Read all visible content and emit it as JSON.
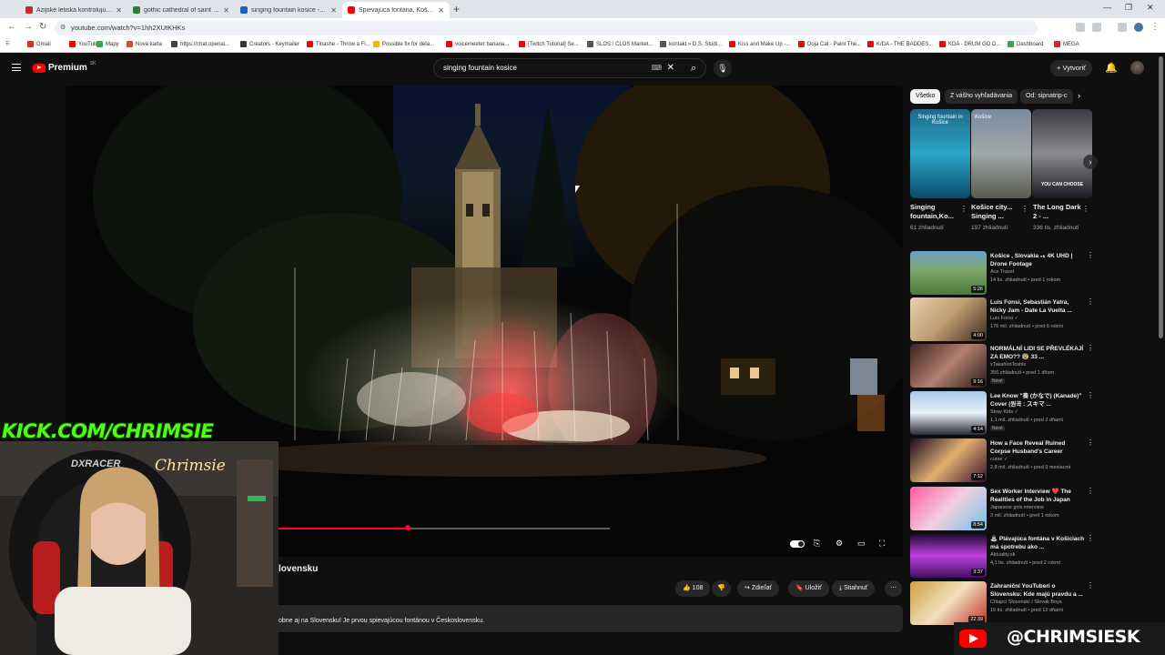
{
  "browser": {
    "tabs": [
      {
        "title": "Ázijské letiská kontrolujú cestu",
        "color": "#c62828"
      },
      {
        "title": "gothic cathedral of saint elizab",
        "color": "#2e7d32"
      },
      {
        "title": "singing fountain kosice - Hľadať",
        "color": "#1565c0"
      },
      {
        "title": "Spievajúca fontána, Košice - no",
        "color": "#ff0000"
      }
    ],
    "url": "youtube.com/watch?v=1hh2XUtKHKs",
    "bookmarks": [
      {
        "label": "Gmail",
        "color": "#d93025"
      },
      {
        "label": "YouTube",
        "color": "#ff0000"
      },
      {
        "label": "Mapy",
        "color": "#34a853"
      },
      {
        "label": "Nová karta",
        "color": "#ea4335"
      },
      {
        "label": "https://chat.openai...",
        "color": "#444"
      },
      {
        "label": "Creators - Keymailer",
        "color": "#333"
      },
      {
        "label": "Tinashe - Throw a Fi...",
        "color": "#ff0000"
      },
      {
        "label": "Possible fix for dela...",
        "color": "#f4b400"
      },
      {
        "label": "voicemeeter banana...",
        "color": "#ff0000"
      },
      {
        "label": "[Twitch Tutorial] Se...",
        "color": "#ff0000"
      },
      {
        "label": "SLOS / CLOS Market...",
        "color": "#555"
      },
      {
        "label": "kontakt » D.S. Studi...",
        "color": "#555"
      },
      {
        "label": "Kiss and Make Up -...",
        "color": "#ff0000"
      },
      {
        "label": "Doja Cat - Paint The...",
        "color": "#ff0000"
      },
      {
        "label": "K/DA - THE BADDES...",
        "color": "#ff0000"
      },
      {
        "label": "KDA - DRUM GO D...",
        "color": "#ff0000"
      },
      {
        "label": "Dashboard",
        "color": "#34a853"
      },
      {
        "label": "MEGA",
        "color": "#d9272e"
      }
    ]
  },
  "yt": {
    "logo_text": "Premium",
    "logo_region": "SK",
    "search_value": "singing fountain kosice",
    "create_label": "Vytvoriť",
    "create_plus": "+"
  },
  "video": {
    "title_visible": "lovensku",
    "progress": 0.39,
    "actions": {
      "like_count": "108",
      "share": "Zdieľať",
      "save": "Uložiť",
      "download": "Stiahnuť"
    },
    "description": "obne aj na Slovensku! Je prvou spievajúcou fontánou v Československu."
  },
  "sidebar": {
    "chips": [
      "Všetko",
      "Z vášho vyhľadávania",
      "Od: sipnatrip-c"
    ],
    "shorts": [
      {
        "title": "Singing fountain,Ko...",
        "views": "61 zhliadnutí",
        "overlay": "Singing fountain in Košice"
      },
      {
        "title": "Košice city... Singing ...",
        "views": "197 zhliadnutí",
        "overlay": "Košice"
      },
      {
        "title": "The Long Dark 2 - ...",
        "views": "336 tis. zhliadnutí",
        "overlay": "YOU CAN CHOOSE"
      }
    ],
    "recommended": [
      {
        "title": "Košice , Slovakia ₅ₖ 4K UHD | Drone Footage",
        "channel": "Ace Travel",
        "meta": "14 tis. zhliadnutí • pred 1 rokom",
        "duration": "5:26",
        "badge": "",
        "thumb": "kosice"
      },
      {
        "title": "Luis Fonsi, Sebastián Yatra, Nicky Jam - Date La Vuelta ...",
        "channel": "Luis Fonsi ✓",
        "meta": "176 mil. zhliadnutí • pred 6 rokmi",
        "duration": "4:00",
        "badge": "",
        "thumb": "fonsi"
      },
      {
        "title": "NORMÁLNÍ LIDI SE PŘEVLÉKAJÍ ZA EMO?? 😰 33 ...",
        "channel": "xTakahiroToshix",
        "meta": "356 zhliadnutí • pred 1 dňom",
        "duration": "9:16",
        "badge": "Nové",
        "thumb": "emo"
      },
      {
        "title": "Lee Know \"奏 (かなで) (Kanade)\" Cover (원곡 : スキマ ...",
        "channel": "Stray Kids ✓",
        "meta": "1,1 mil. zhliadnutí • pred 2 dňami",
        "duration": "4:14",
        "badge": "Nové",
        "thumb": "leeknow"
      },
      {
        "title": "How a Face Reveal Ruined Corpse Husband's Career",
        "channel": "curse ✓",
        "meta": "2,8 mil. zhliadnutí • pred 9 mesiacmi",
        "duration": "7:12",
        "badge": "",
        "thumb": "corpse"
      },
      {
        "title": "Sex Worker Interview ❤️ The Realities of the Job in Japan",
        "channel": "Japanese girls interview",
        "meta": "3 mil. zhliadnutí • pred 1 rokom",
        "duration": "8:54",
        "badge": "",
        "thumb": "japan"
      },
      {
        "title": "⛲ Plávajúca fontána v Košiciach má spotrebu ako ...",
        "channel": "Aktuality.sk",
        "meta": "4,1 tis. zhliadnutí • pred 2 rokmi",
        "duration": "3:37",
        "badge": "",
        "thumb": "fountain"
      },
      {
        "title": "Zahraniční YouTuberi o Slovensku: Kde majú pravdu a ...",
        "channel": "Chlapci Slovenskí / Slovak Boys",
        "meta": "16 tis. zhliadnutí • pred 12 dňami",
        "duration": "22:39",
        "badge": "",
        "thumb": "youtubers"
      }
    ]
  },
  "overlay": {
    "kick_text": "KICK.COM/CHRIMSIE",
    "yt_handle": "@CHRIMSIESK",
    "neon_sign": "Chrimsie",
    "chair_brand": "DXRACER"
  }
}
